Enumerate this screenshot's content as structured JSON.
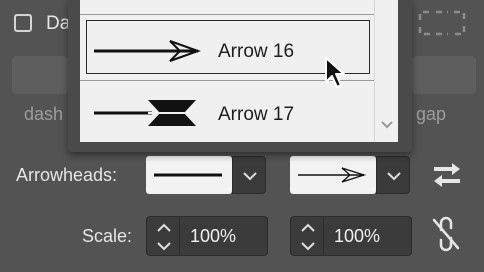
{
  "stroke_panel": {
    "dashed_checkbox_label": "Da",
    "dash_field_label": "dash",
    "gap_field_label": "gap",
    "arrowheads_label": "Arrowheads:",
    "scale_label": "Scale:",
    "scale_start_value": "100%",
    "scale_end_value": "100%"
  },
  "arrow_dropdown": {
    "items": [
      {
        "label": "Arrow 16",
        "state": "hover"
      },
      {
        "label": "Arrow 17",
        "state": "normal"
      }
    ]
  },
  "colors": {
    "panel_bg": "#535353",
    "field_bg": "#3b3b3b",
    "dropdown_bg": "#f0f0f0",
    "text": "#e6e6e6",
    "muted_text": "#9c9c9c"
  }
}
